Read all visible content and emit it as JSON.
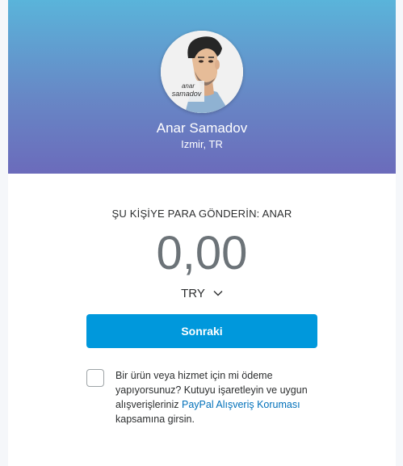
{
  "profile": {
    "avatar_caption_line1": "anar",
    "avatar_caption_line2": "samadov",
    "name": "Anar Samadov",
    "location": "Izmir, TR"
  },
  "send": {
    "label": "ŞU KİŞİYE PARA GÖNDERİN: ANAR",
    "amount": "0,00",
    "currency": "TRY",
    "currency_icon": "chevron-down-icon"
  },
  "next_button": {
    "label": "Sonraki"
  },
  "purchase_protection": {
    "checked": false,
    "text_before": "Bir ürün veya hizmet için mi ödeme yapıyorsunuz? Kutuyu işaretleyin ve uygun alışverişleriniz",
    "link_text": "PayPal Alışveriş Koruması",
    "text_after": "kapsamına girsin."
  },
  "colors": {
    "header_gradient_top": "#5ab4da",
    "header_gradient_bottom": "#6b6bbb",
    "button": "#0098dc",
    "link": "#0070ba"
  }
}
